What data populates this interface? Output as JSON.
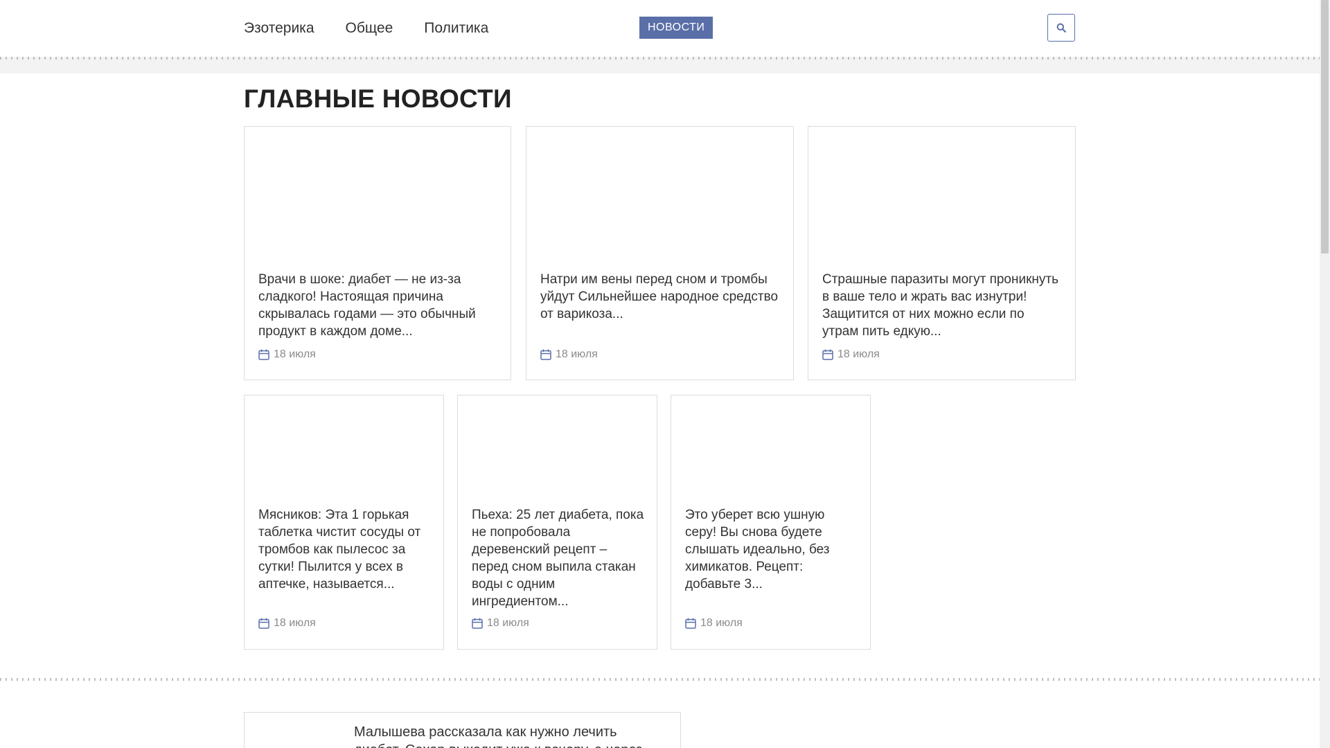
{
  "nav": {
    "items": [
      {
        "label": "Эзотерика"
      },
      {
        "label": "Общее"
      },
      {
        "label": "Политика"
      }
    ],
    "news_button": "НОВОСТИ",
    "search_icon": "search-icon"
  },
  "section": {
    "title": "ГЛАВНЫЕ НОВОСТИ"
  },
  "cards": [
    {
      "title": "Врачи в шоке: диабет — не из-за сладкого! Настоящая причина скрывалась годами — это обычный продукт в каждом доме...",
      "date": "18 июля"
    },
    {
      "title": "Натри им вены перед сном и тромбы уйдут Сильнейшее народное средство от варикоза...",
      "date": "18 июля"
    },
    {
      "title": "Страшные паразиты могут проникнуть в ваше тело и жрать вас изнутри! Защитится от них можно если по утрам пить едкую...",
      "date": "18 июля"
    },
    {
      "title": "Мясников: Эта 1 горькая таблетка чистит сосуды от тромбов как пылесос за сутки! Пылится у всех в аптечке, называется...",
      "date": "18 июля"
    },
    {
      "title": "Пьеха: 25 лет диабета, пока не попробовала деревенский рецепт – перед сном выпила стакан воды с одним ингредиентом...",
      "date": "18 июля"
    },
    {
      "title": "Это уберет всю ушную серу! Вы снова будете слышать идеально, без химикатов. Рецепт: добавьте 3...",
      "date": "18 июля"
    }
  ],
  "wide_card": {
    "title": "Малышева рассказала как нужно лечить диабет. Сахар выходит уже к вечеру, а через три дня..."
  },
  "colors": {
    "accent": "#5a6fa8",
    "date_icon": "#5a6fa8"
  }
}
